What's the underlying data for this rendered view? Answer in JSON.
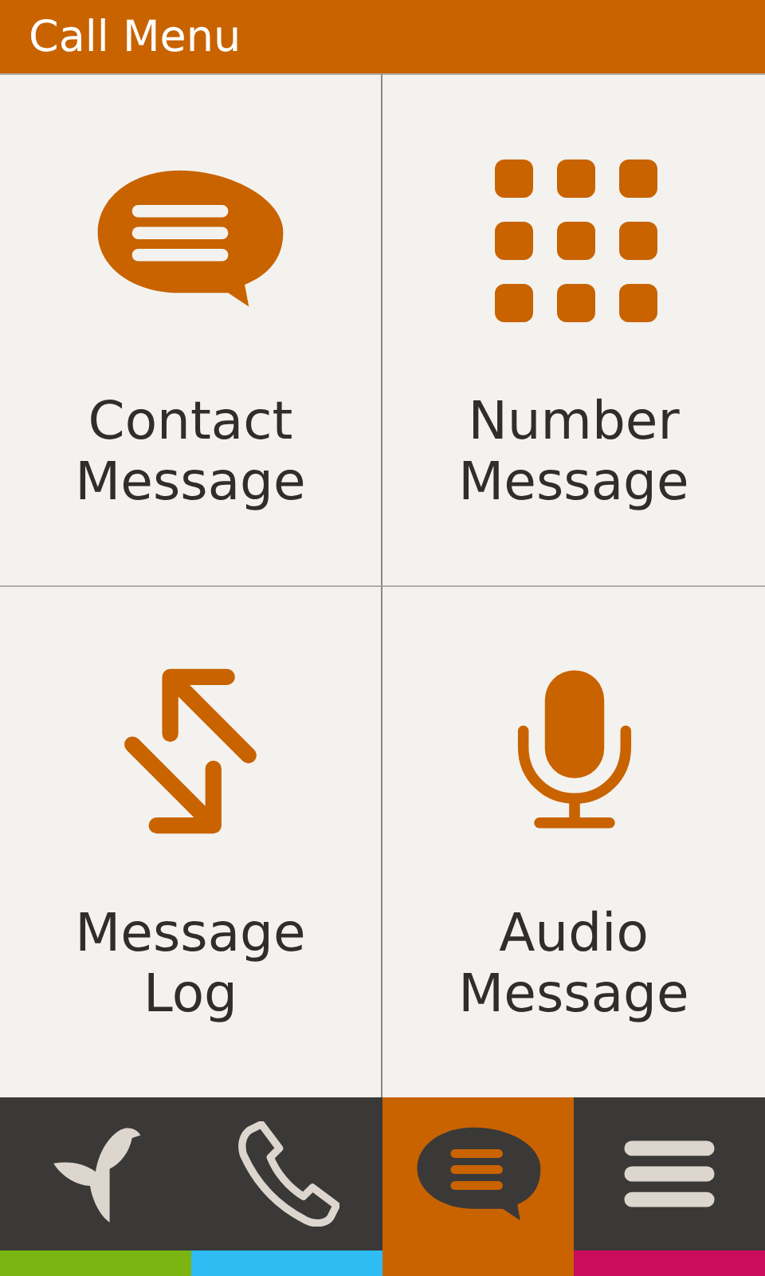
{
  "header": {
    "title": "Call Menu"
  },
  "tiles": [
    {
      "label": "Contact Message"
    },
    {
      "label": "Number Message"
    },
    {
      "label": "Message Log"
    },
    {
      "label": "Audio Message"
    }
  ],
  "nav": [
    {
      "selected": false,
      "color": "#7ab511"
    },
    {
      "selected": false,
      "color": "#2ebcf2"
    },
    {
      "selected": true,
      "color": "#c86300"
    },
    {
      "selected": false,
      "color": "#cb0b5c"
    }
  ]
}
